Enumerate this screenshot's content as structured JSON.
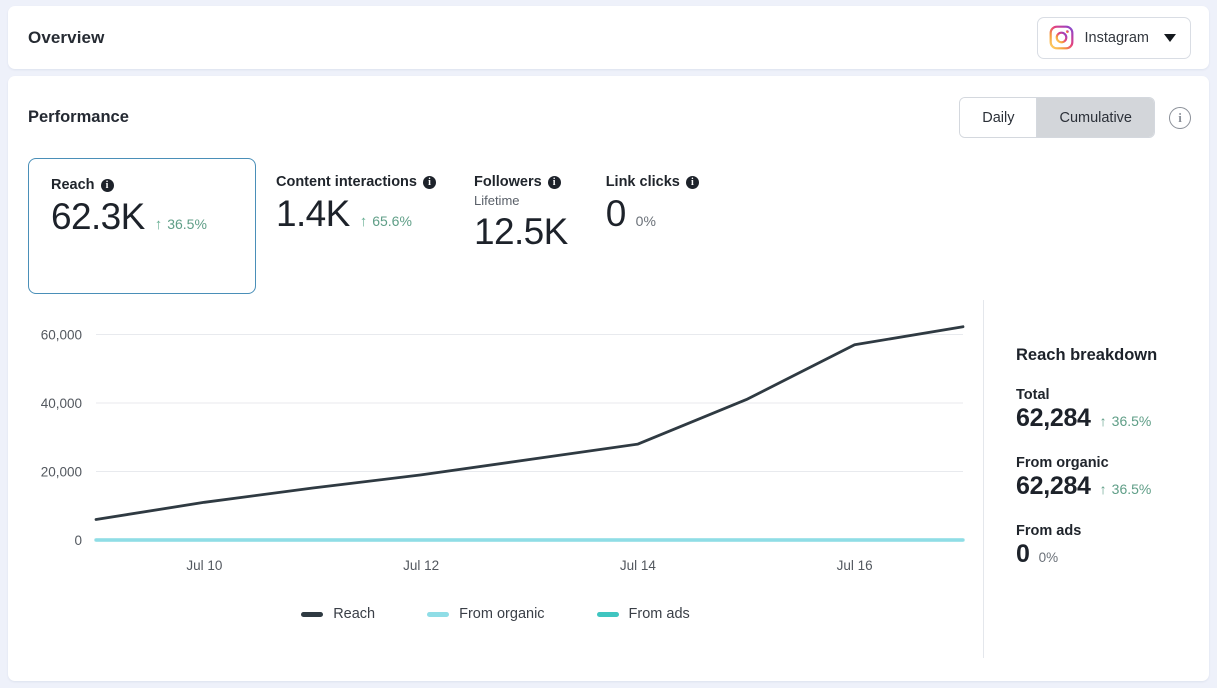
{
  "header": {
    "title": "Overview",
    "platform": {
      "name": "Instagram",
      "icon": "instagram-icon",
      "caret": "chevron-down-icon"
    }
  },
  "performance": {
    "title": "Performance",
    "toggle": {
      "options": [
        "Daily",
        "Cumulative"
      ],
      "selected": "Cumulative"
    },
    "info_icon": "info-icon",
    "kpis": [
      {
        "label": "Reach",
        "sublabel": "",
        "value": "62.3K",
        "delta": "36.5%",
        "arrow": "↑",
        "direction": "up",
        "selected": true
      },
      {
        "label": "Content interactions",
        "sublabel": "",
        "value": "1.4K",
        "delta": "65.6%",
        "arrow": "↑",
        "direction": "up",
        "selected": false
      },
      {
        "label": "Followers",
        "sublabel": "Lifetime",
        "value": "12.5K",
        "delta": "",
        "arrow": "",
        "direction": "none",
        "selected": false
      },
      {
        "label": "Link clicks",
        "sublabel": "",
        "value": "0",
        "delta": "0%",
        "arrow": "",
        "direction": "flat",
        "selected": false
      }
    ],
    "breakdown": {
      "title": "Reach breakdown",
      "rows": [
        {
          "label": "Total",
          "value": "62,284",
          "delta": "36.5%",
          "arrow": "↑",
          "direction": "up"
        },
        {
          "label": "From organic",
          "value": "62,284",
          "delta": "36.5%",
          "arrow": "↑",
          "direction": "up"
        },
        {
          "label": "From ads",
          "value": "0",
          "delta": "0%",
          "arrow": "",
          "direction": "flat"
        }
      ]
    }
  },
  "colors": {
    "accent_selected_border": "#4a8fb8",
    "positive": "#5f9e87",
    "reach_line": "#2f3a42",
    "from_organic_line": "#8fdde6",
    "from_ads_line": "#3fc5c0",
    "grid": "#e8eaee",
    "page_bg": "#eef1fa"
  },
  "chart_data": {
    "type": "line",
    "title": "",
    "xlabel": "",
    "ylabel": "",
    "grid": true,
    "legend_position": "bottom",
    "ylim": [
      0,
      66000
    ],
    "yticks": [
      0,
      20000,
      40000,
      60000
    ],
    "ytick_labels": [
      "0",
      "20,000",
      "40,000",
      "60,000"
    ],
    "x": [
      "Jul 9",
      "Jul 10",
      "Jul 11",
      "Jul 12",
      "Jul 13",
      "Jul 14",
      "Jul 15",
      "Jul 16",
      "Jul 17"
    ],
    "xtick_labels": [
      "Jul 10",
      "Jul 12",
      "Jul 14",
      "Jul 16"
    ],
    "series": [
      {
        "name": "Reach",
        "color": "#2f3a42",
        "values": [
          6000,
          11000,
          15200,
          19000,
          23500,
          28000,
          41000,
          57000,
          62284
        ]
      },
      {
        "name": "From organic",
        "color": "#8fdde6",
        "values": [
          0,
          0,
          0,
          0,
          0,
          0,
          0,
          0,
          0
        ]
      },
      {
        "name": "From ads",
        "color": "#3fc5c0",
        "values": [
          0,
          0,
          0,
          0,
          0,
          0,
          0,
          0,
          0
        ]
      }
    ]
  }
}
